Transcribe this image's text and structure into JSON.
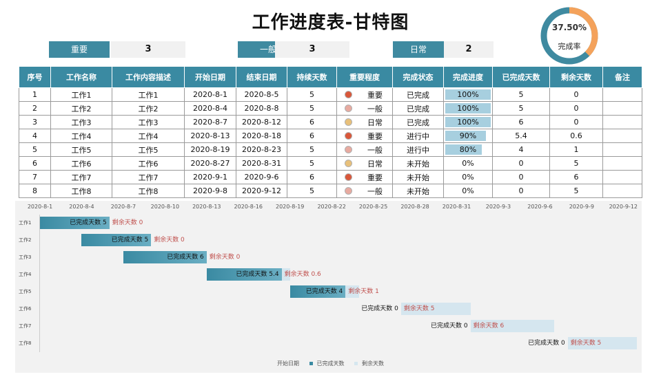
{
  "title": "工作进度表-甘特图",
  "completion": {
    "percent_text": "37.50%",
    "label": "完成率",
    "value": 0.375
  },
  "summary": [
    {
      "label": "重要",
      "count": "3"
    },
    {
      "label": "一般",
      "count": "3"
    },
    {
      "label": "日常",
      "count": "2"
    }
  ],
  "table": {
    "headers": [
      "序号",
      "工作名称",
      "工作内容描述",
      "开始日期",
      "结束日期",
      "持续天数",
      "重要程度",
      "完成状态",
      "完成进度",
      "已完成天数",
      "剩余天数",
      "备注"
    ],
    "rows": [
      {
        "no": "1",
        "name": "工作1",
        "desc": "工作1",
        "start": "2020-8-1",
        "end": "2020-8-5",
        "dur": "5",
        "importance": "重要",
        "status": "已完成",
        "progress": "100%",
        "progress_value": 1.0,
        "done": "5",
        "remain": "0",
        "note": ""
      },
      {
        "no": "2",
        "name": "工作2",
        "desc": "工作2",
        "start": "2020-8-4",
        "end": "2020-8-8",
        "dur": "5",
        "importance": "一般",
        "status": "已完成",
        "progress": "100%",
        "progress_value": 1.0,
        "done": "5",
        "remain": "0",
        "note": ""
      },
      {
        "no": "3",
        "name": "工作3",
        "desc": "工作3",
        "start": "2020-8-7",
        "end": "2020-8-12",
        "dur": "6",
        "importance": "日常",
        "status": "已完成",
        "progress": "100%",
        "progress_value": 1.0,
        "done": "6",
        "remain": "0",
        "note": ""
      },
      {
        "no": "4",
        "name": "工作4",
        "desc": "工作4",
        "start": "2020-8-13",
        "end": "2020-8-18",
        "dur": "6",
        "importance": "重要",
        "status": "进行中",
        "progress": "90%",
        "progress_value": 0.9,
        "done": "5.4",
        "remain": "0.6",
        "note": ""
      },
      {
        "no": "5",
        "name": "工作5",
        "desc": "工作5",
        "start": "2020-8-19",
        "end": "2020-8-23",
        "dur": "5",
        "importance": "一般",
        "status": "进行中",
        "progress": "80%",
        "progress_value": 0.8,
        "done": "4",
        "remain": "1",
        "note": ""
      },
      {
        "no": "6",
        "name": "工作6",
        "desc": "工作6",
        "start": "2020-8-27",
        "end": "2020-8-31",
        "dur": "5",
        "importance": "日常",
        "status": "未开始",
        "progress": "0%",
        "progress_value": 0,
        "done": "0",
        "remain": "5",
        "note": ""
      },
      {
        "no": "7",
        "name": "工作7",
        "desc": "工作7",
        "start": "2020-9-1",
        "end": "2020-9-6",
        "dur": "6",
        "importance": "重要",
        "status": "未开始",
        "progress": "0%",
        "progress_value": 0,
        "done": "0",
        "remain": "6",
        "note": ""
      },
      {
        "no": "8",
        "name": "工作8",
        "desc": "工作8",
        "start": "2020-9-8",
        "end": "2020-9-12",
        "dur": "5",
        "importance": "一般",
        "status": "未开始",
        "progress": "0%",
        "progress_value": 0,
        "done": "0",
        "remain": "5",
        "note": ""
      }
    ]
  },
  "importance_colors": {
    "重要": "#d9573a",
    "一般": "#e8aaa0",
    "日常": "#e8c07a"
  },
  "colors": {
    "header": "#3a8aa2",
    "done_bar": "#3a8aa2",
    "remain_bar": "#d5e6ef",
    "remain_text": "#c0504d",
    "donut_track": "#3f8aa0",
    "donut_fill": "#f4a25b"
  },
  "chart_data": {
    "type": "bar",
    "orientation": "horizontal",
    "stacked": true,
    "x_axis": {
      "type": "date",
      "min": "2020-8-1",
      "max": "2020-9-12",
      "tick_labels": [
        "2020-8-1",
        "2020-8-4",
        "2020-8-7",
        "2020-8-10",
        "2020-8-13",
        "2020-8-16",
        "2020-8-19",
        "2020-8-22",
        "2020-8-25",
        "2020-8-28",
        "2020-8-31",
        "2020-9-3",
        "2020-9-6",
        "2020-9-9",
        "2020-9-12"
      ]
    },
    "categories": [
      "工作1",
      "工作2",
      "工作3",
      "工作4",
      "工作5",
      "工作6",
      "工作7",
      "工作8"
    ],
    "series": [
      {
        "name": "开始日期",
        "values": [
          "2020-8-1",
          "2020-8-4",
          "2020-8-7",
          "2020-8-13",
          "2020-8-19",
          "2020-8-27",
          "2020-9-1",
          "2020-9-8"
        ]
      },
      {
        "name": "已完成天数",
        "values": [
          5,
          5,
          6,
          5.4,
          4,
          0,
          0,
          0
        ]
      },
      {
        "name": "剩余天数",
        "values": [
          0,
          0,
          0,
          0.6,
          1,
          5,
          6,
          5
        ]
      }
    ],
    "done_label_prefix": "已完成天数",
    "remain_label_prefix": "剩余天数",
    "legend": "bottom"
  }
}
